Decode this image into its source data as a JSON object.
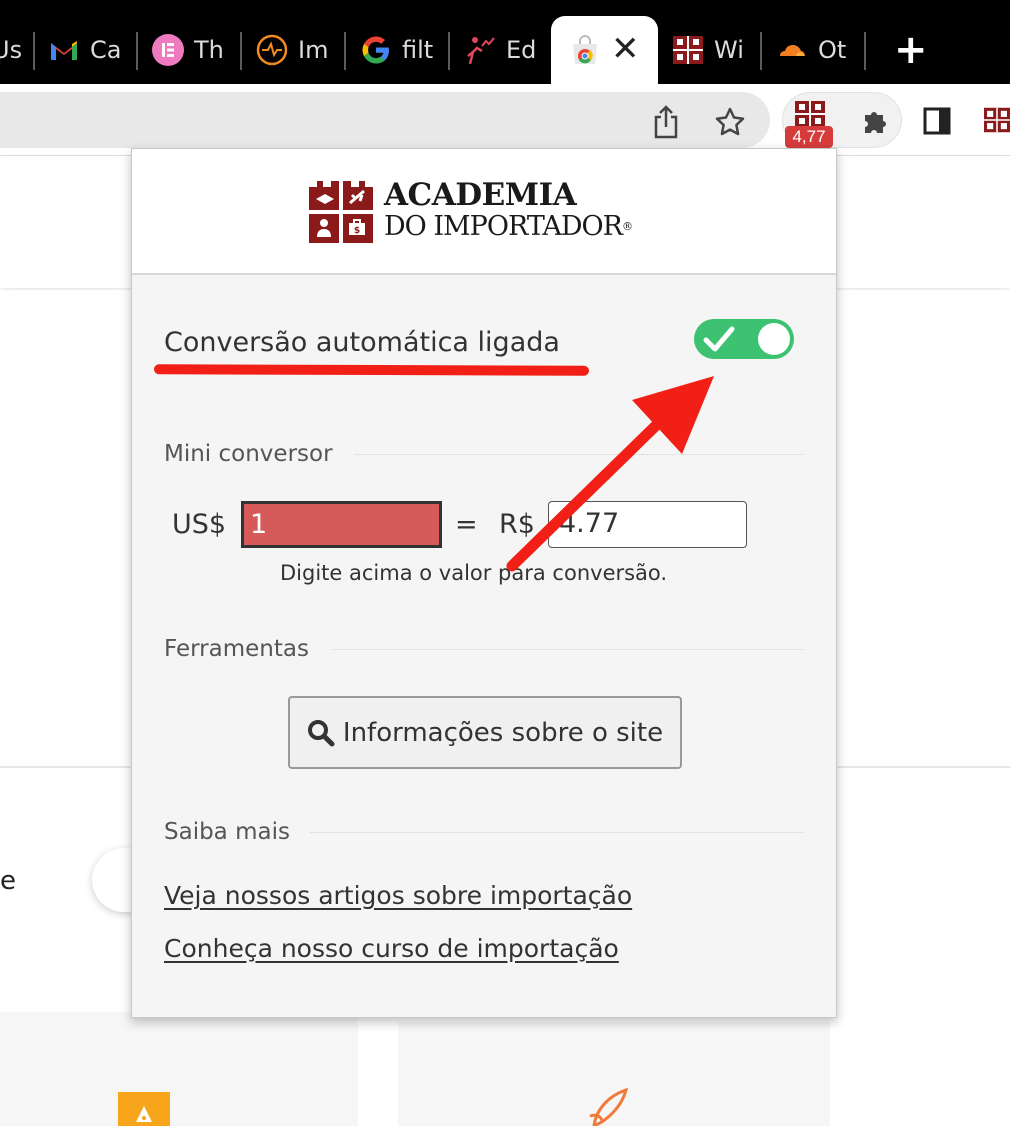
{
  "tabs": [
    {
      "title": "Us",
      "icon": "partial-favicon-icon"
    },
    {
      "title": "Ca",
      "icon": "gmail-icon"
    },
    {
      "title": "Th",
      "icon": "elementor-icon"
    },
    {
      "title": "Im",
      "icon": "pulse-icon"
    },
    {
      "title": "filt",
      "icon": "google-icon"
    },
    {
      "title": "Ed",
      "icon": "person-chart-icon"
    },
    {
      "title": "",
      "icon": "chrome-web-store-icon",
      "active": true
    },
    {
      "title": "Wi",
      "icon": "academia-icon"
    },
    {
      "title": "Ot",
      "icon": "cloudflare-icon"
    }
  ],
  "toolbar": {
    "extension_badge": "4,77"
  },
  "page": {
    "partial_text": "e"
  },
  "popup": {
    "logo": {
      "line1": "ACADEMIA",
      "line2": "DO IMPORTADOR",
      "registered": "®"
    },
    "auto_conversion_label": "Conversão automática ligada",
    "auto_conversion_on": true,
    "mini_converter": {
      "title": "Mini conversor",
      "usd_label": "US$",
      "usd_value": "1",
      "equals": "=",
      "brl_label": "R$",
      "brl_value": "4.77",
      "hint": "Digite acima o valor para conversão."
    },
    "tools": {
      "title": "Ferramentas",
      "info_button": "Informações sobre o site"
    },
    "learn_more": {
      "title": "Saiba mais",
      "links": [
        "Veja nossos artigos sobre importação",
        "Conheça nosso curso de importação"
      ]
    }
  },
  "colors": {
    "brand_red": "#8b1a1a",
    "toggle_on": "#3dc271",
    "annotation_red": "#f11f15",
    "usd_input_bg": "#d75a5a"
  }
}
